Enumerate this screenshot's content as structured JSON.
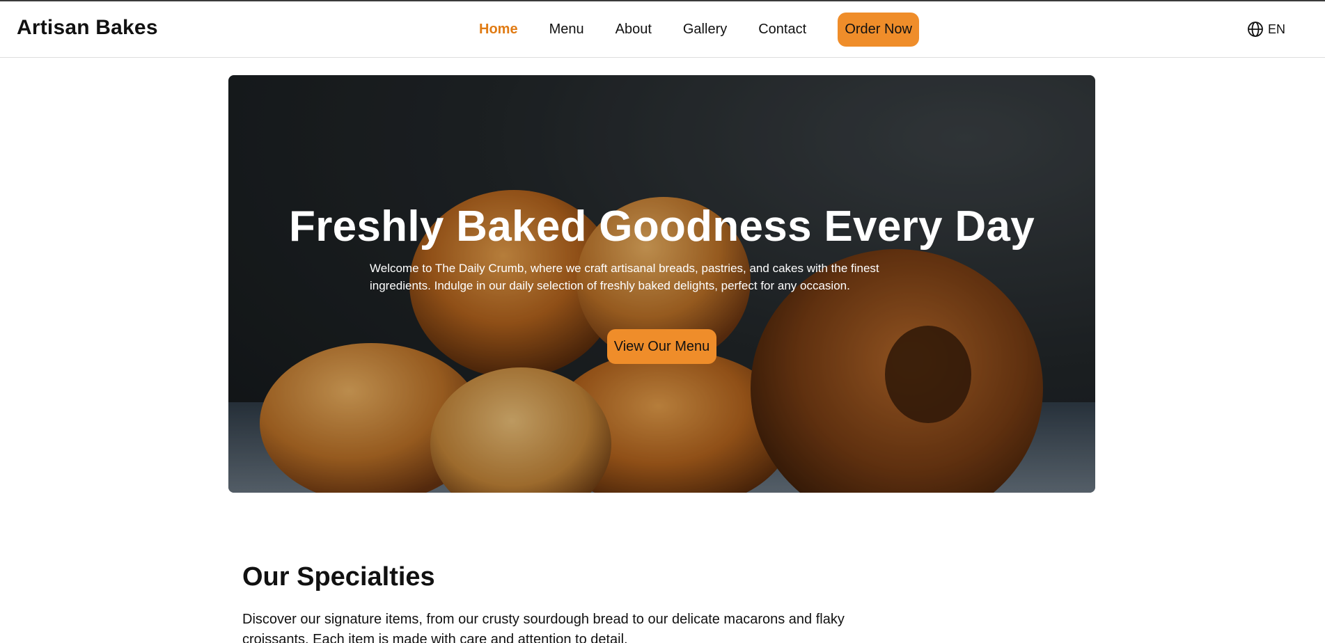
{
  "header": {
    "brand": "Artisan Bakes",
    "nav": [
      {
        "label": "Home",
        "active": true
      },
      {
        "label": "Menu"
      },
      {
        "label": "About"
      },
      {
        "label": "Gallery"
      },
      {
        "label": "Contact"
      }
    ],
    "order_button": "Order Now",
    "language": {
      "icon": "globe-icon",
      "label": "EN"
    }
  },
  "hero": {
    "title": "Freshly Baked Goodness Every Day",
    "text": "Welcome to The Daily Crumb, where we craft artisanal breads, pastries, and cakes with the finest ingredients. Indulge in our daily selection of freshly baked delights, perfect for any occasion.",
    "cta": "View Our Menu",
    "image_subject": "bread-rolls-and-bagels-photo"
  },
  "specialties": {
    "title": "Our Specialties",
    "text": "Discover our signature items, from our crusty sourdough bread to our delicate macarons and flaky croissants. Each item is made with care and attention to detail."
  },
  "colors": {
    "accent": "#ef8d2a",
    "active_nav": "#e07b14",
    "text": "#111111"
  }
}
